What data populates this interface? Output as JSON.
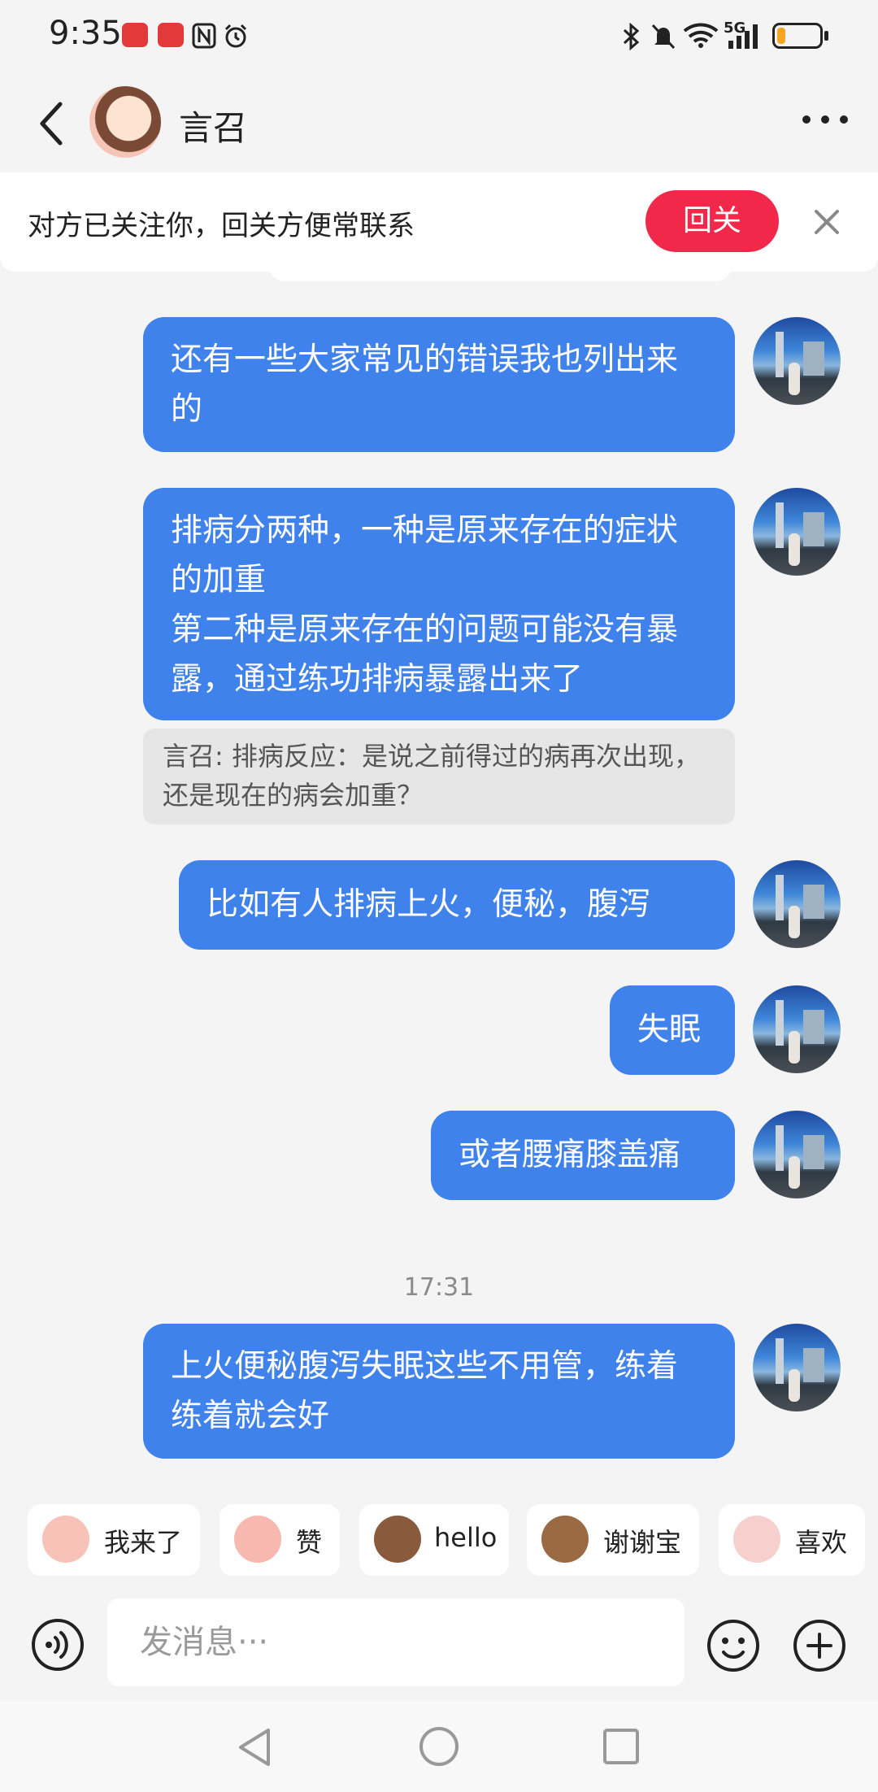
{
  "status_bar": {
    "time": "9:35",
    "network": "5G",
    "battery_level": 0.2
  },
  "header": {
    "contact_name": "言召",
    "back_icon": "chevron-left-icon",
    "more_icon": "more-horizontal-icon"
  },
  "follow_banner": {
    "text": "对方已关注你，回关方便常联系",
    "button_label": "回关",
    "close_icon": "close-icon"
  },
  "messages": [
    {
      "text": "还有一些大家常见的错误我也列出来的"
    },
    {
      "text": "排病分两种，一种是原来存在的症状的加重\n第二种是原来存在的问题可能没有暴露，通过练功排病暴露出来了"
    },
    {
      "quote": "言召: 排病反应：是说之前得过的病再次出现，还是现在的病会加重？"
    },
    {
      "text": "比如有人排病上火，便秘，腹泻"
    },
    {
      "text": "失眠"
    },
    {
      "text": "或者腰痛膝盖痛"
    },
    {
      "timestamp": "17:31"
    },
    {
      "text": "上火便秘腹泻失眠这些不用管，练着练着就会好"
    }
  ],
  "quick_replies": [
    {
      "label": "我来了"
    },
    {
      "label": "赞"
    },
    {
      "label": "hello"
    },
    {
      "label": "谢谢宝"
    },
    {
      "label": "喜欢"
    }
  ],
  "input": {
    "placeholder": "发消息···",
    "voice_icon": "voice-icon",
    "emoji_icon": "emoji-icon",
    "plus_icon": "plus-icon"
  },
  "colors": {
    "bubble": "#3f82ec",
    "follow_button": "#f2284a",
    "background": "#f4f4f4"
  }
}
